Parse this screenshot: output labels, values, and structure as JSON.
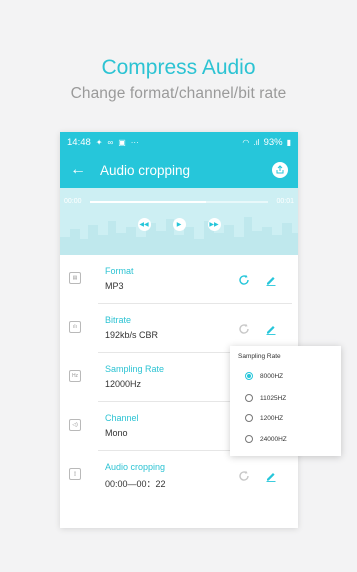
{
  "promo": {
    "title": "Compress Audio",
    "subtitle": "Change format/channel/bit rate"
  },
  "statusbar": {
    "time": "14:48",
    "battery": "93%"
  },
  "toolbar": {
    "title": "Audio cropping"
  },
  "player": {
    "start_time": "00:00",
    "end_time": "00:01",
    "progress": 0.65
  },
  "settings": [
    {
      "label": "Format",
      "value": "MP3",
      "icon": "file-icon",
      "active": true
    },
    {
      "label": "Bitrate",
      "value": "192kb/s CBR",
      "icon": "bars-icon",
      "active": false
    },
    {
      "label": "Sampling Rate",
      "value": "12000Hz",
      "icon": "hz-icon",
      "active": false
    },
    {
      "label": "Channel",
      "value": "Mono",
      "icon": "speaker-icon",
      "active": false
    },
    {
      "label": "Audio cropping",
      "value": "00:00—00：22",
      "icon": "crop-icon",
      "active": false
    }
  ],
  "popup": {
    "title": "Sampling Rate",
    "options": [
      "8000HZ",
      "11025HZ",
      "1200HZ",
      "24000HZ"
    ],
    "selected_index": 0
  },
  "colors": {
    "accent": "#26c6da",
    "title_text": "#2cc3d3",
    "subtitle_text": "#9a9a9a"
  }
}
